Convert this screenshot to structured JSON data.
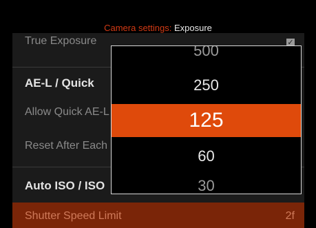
{
  "header": {
    "category": "Camera settings:",
    "subtitle": "Exposure"
  },
  "settings": {
    "true_exposure": {
      "label": "True Exposure",
      "checked": true
    },
    "ae_lock": {
      "label": "AE-L / Quick"
    },
    "allow_quick": {
      "label": "Allow Quick AE-L"
    },
    "reset_after": {
      "label": "Reset After Each Shot"
    },
    "auto_iso": {
      "label": "Auto ISO / ISO"
    },
    "shutter_speed_limit": {
      "label": "Shutter Speed Limit",
      "value": "2f"
    }
  },
  "picker": {
    "items": [
      "500",
      "250",
      "125",
      "60",
      "30"
    ],
    "selected_index": 2
  },
  "colors": {
    "accent": "#df4a0b",
    "header_accent": "#d23a14",
    "row_highlight": "#7a2508"
  }
}
